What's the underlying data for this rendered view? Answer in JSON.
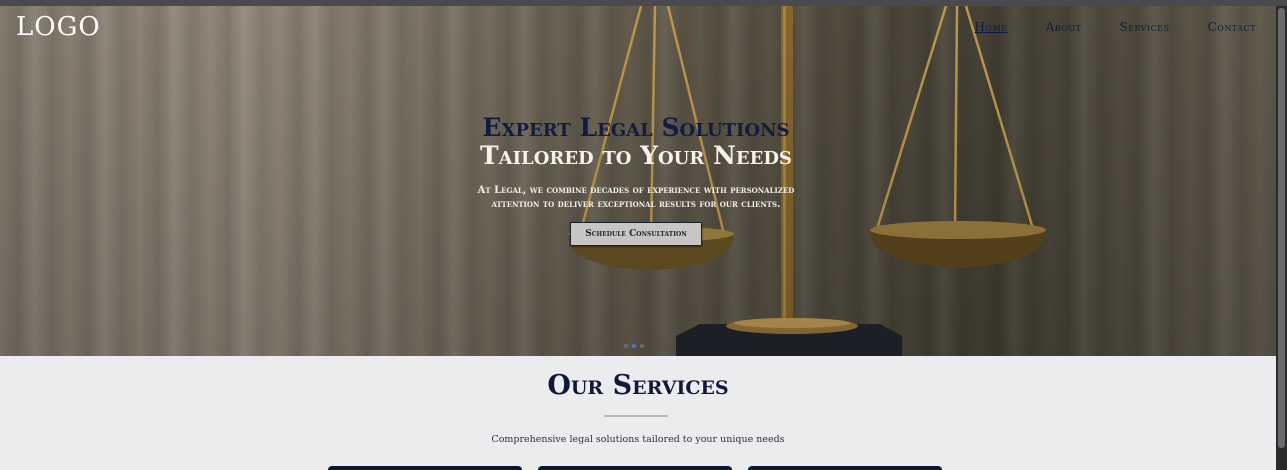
{
  "header": {
    "logo": "LOGO",
    "nav": [
      {
        "label": "Home",
        "active": true
      },
      {
        "label": "About",
        "active": false
      },
      {
        "label": "Services",
        "active": false
      },
      {
        "label": "Contact",
        "active": false
      }
    ]
  },
  "hero": {
    "title_line1": "Expert Legal Solutions",
    "title_line2": "Tailored to Your Needs",
    "subtitle": "At Legal, we combine decades of experience with personalized attention to deliver exceptional results for our clients.",
    "cta_label": "Schedule Consultation",
    "carousel": {
      "slides": 3,
      "active_index": 1
    }
  },
  "services": {
    "title": "Our Services",
    "subtitle": "Comprehensive legal solutions tailored to your unique needs",
    "cards_visible": 3
  },
  "colors": {
    "navy": "#0f1838",
    "accent_dot": "#3f7ec4",
    "section_bg": "#ececee"
  }
}
